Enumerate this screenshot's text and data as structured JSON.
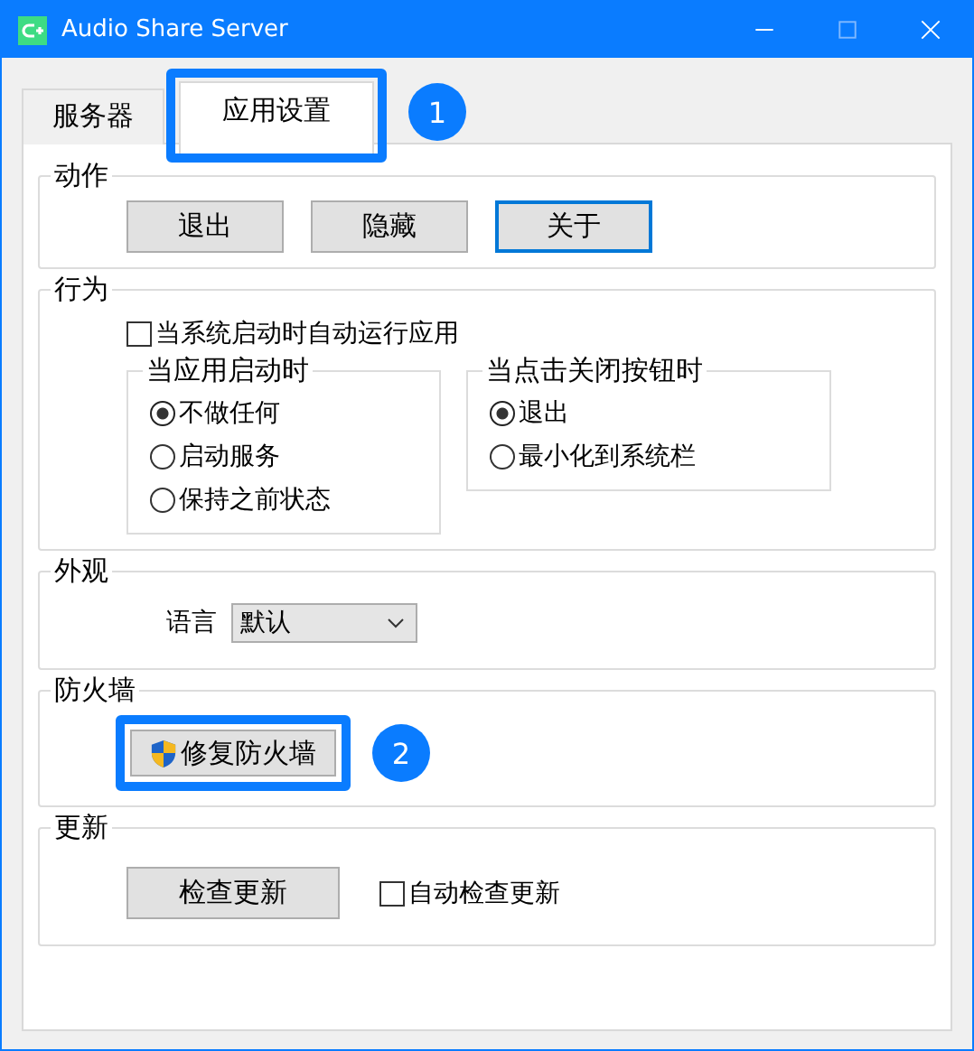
{
  "window": {
    "title": "Audio Share Server"
  },
  "tabs": [
    {
      "label": "服务器",
      "selected": false,
      "highlighted": false
    },
    {
      "label": "应用设置",
      "selected": true,
      "highlighted": true,
      "callout": "1"
    }
  ],
  "sections": [
    {
      "kind": "actions",
      "title": "动作",
      "buttons": [
        {
          "label": "退出",
          "focused": false
        },
        {
          "label": "隐藏",
          "focused": false
        },
        {
          "label": "关于",
          "focused": true
        }
      ]
    },
    {
      "kind": "behavior",
      "title": "行为",
      "autostart": {
        "label": "当系统启动时自动运行应用",
        "checked": false
      },
      "groups": [
        {
          "title": "当应用启动时",
          "options": [
            {
              "label": "不做任何",
              "selected": true
            },
            {
              "label": "启动服务",
              "selected": false
            },
            {
              "label": "保持之前状态",
              "selected": false
            }
          ]
        },
        {
          "title": "当点击关闭按钮时",
          "options": [
            {
              "label": "退出",
              "selected": true
            },
            {
              "label": "最小化到系统栏",
              "selected": false
            }
          ]
        }
      ]
    },
    {
      "kind": "appearance",
      "title": "外观",
      "language_label": "语言",
      "language_value": "默认"
    },
    {
      "kind": "firewall",
      "title": "防火墙",
      "button": {
        "label": "修复防火墙",
        "highlighted": true,
        "callout": "2"
      }
    },
    {
      "kind": "update",
      "title": "更新",
      "button": "检查更新",
      "auto_check": {
        "label": "自动检查更新",
        "checked": false
      }
    }
  ]
}
